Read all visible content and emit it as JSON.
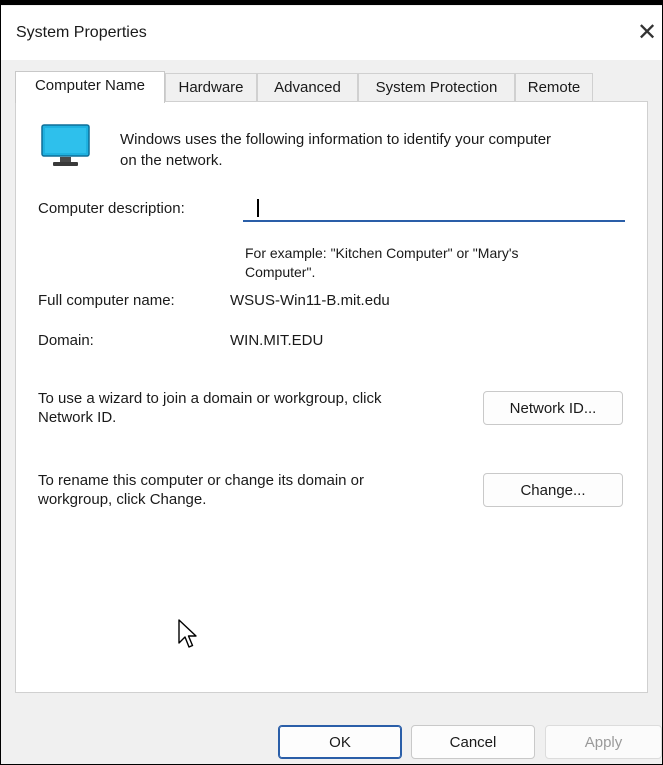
{
  "window": {
    "title": "System Properties",
    "close_glyph": "✕"
  },
  "tabs": [
    {
      "label": "Computer Name",
      "active": true
    },
    {
      "label": "Hardware",
      "active": false
    },
    {
      "label": "Advanced",
      "active": false
    },
    {
      "label": "System Protection",
      "active": false
    },
    {
      "label": "Remote",
      "active": false
    }
  ],
  "computer_name": {
    "info_line1": "Windows uses the following information to identify your computer",
    "info_line2": "on the network.",
    "description_label": "Computer description:",
    "description_value": "",
    "example_line1": "For example: \"Kitchen Computer\" or \"Mary's",
    "example_line2": "Computer\".",
    "full_name_label": "Full computer name:",
    "full_name_value": "WSUS-Win11-B.mit.edu",
    "domain_label": "Domain:",
    "domain_value": "WIN.MIT.EDU",
    "wizard_line1": "To use a wizard to join a domain or workgroup, click",
    "wizard_line2": "Network ID.",
    "network_id_button": "Network ID...",
    "rename_line1": "To rename this computer or change its domain or",
    "rename_line2": "workgroup, click Change.",
    "change_button": "Change..."
  },
  "footer": {
    "ok": "OK",
    "cancel": "Cancel",
    "apply": "Apply"
  },
  "icons": {
    "computer": "monitor-icon",
    "cursor": "mouse-pointer-icon"
  },
  "colors": {
    "accent": "#2a5ea8",
    "monitor_screen": "#1fb1e0"
  }
}
